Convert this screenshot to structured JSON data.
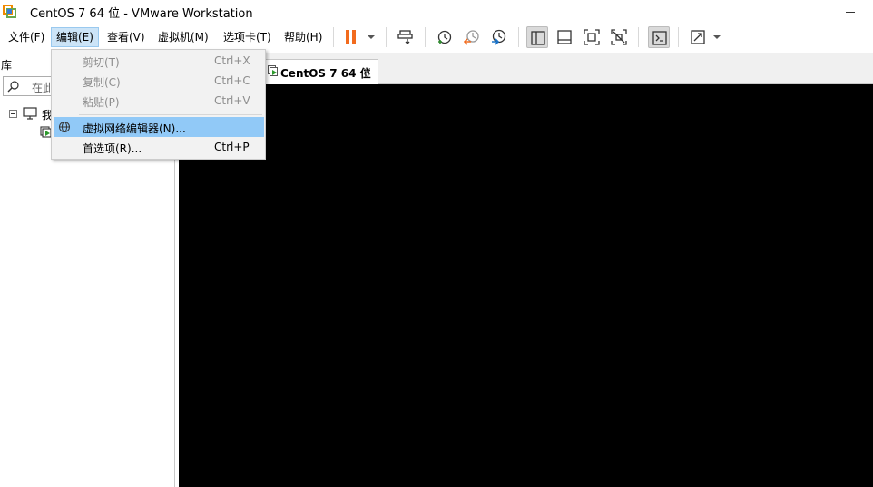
{
  "window": {
    "title": "CentOS 7 64 位 - VMware Workstation",
    "logo_icon": "vmware-logo-icon",
    "minimize_icon": "minimize-icon"
  },
  "menubar": {
    "items": [
      {
        "label": "文件(F)"
      },
      {
        "label": "编辑(E)"
      },
      {
        "label": "查看(V)"
      },
      {
        "label": "虚拟机(M)"
      },
      {
        "label": "选项卡(T)"
      },
      {
        "label": "帮助(H)"
      }
    ],
    "active_index": 1
  },
  "toolbar": {
    "icons": [
      "pause-icon",
      "dropdown-caret-icon",
      "send-ctrl-alt-del-icon",
      "snapshot-icon",
      "revert-snapshot-icon",
      "snapshot-manager-icon",
      "library-view-icon",
      "thumbnail-bar-icon",
      "fullscreen-icon",
      "unity-icon",
      "console-view-icon",
      "stretch-guest-icon",
      "dropdown-caret-icon"
    ],
    "accent_color": "#f26b1d"
  },
  "library": {
    "title": "库",
    "search_text": "在此",
    "tree": {
      "root_label": "我"
    }
  },
  "tabs": [
    {
      "label": "CentOS 7 64 位",
      "close_glyph": "×"
    }
  ],
  "edit_menu": {
    "items": [
      {
        "label": "剪切(T)",
        "shortcut": "Ctrl+X",
        "enabled": false
      },
      {
        "label": "复制(C)",
        "shortcut": "Ctrl+C",
        "enabled": false
      },
      {
        "label": "粘贴(P)",
        "shortcut": "Ctrl+V",
        "enabled": false
      },
      {
        "label": "虚拟网络编辑器(N)...",
        "shortcut": "",
        "enabled": true,
        "highlighted": true,
        "icon": "network-globe-icon"
      },
      {
        "label": "首选项(R)...",
        "shortcut": "Ctrl+P",
        "enabled": true
      }
    ]
  },
  "console": {
    "background": "#000000"
  }
}
